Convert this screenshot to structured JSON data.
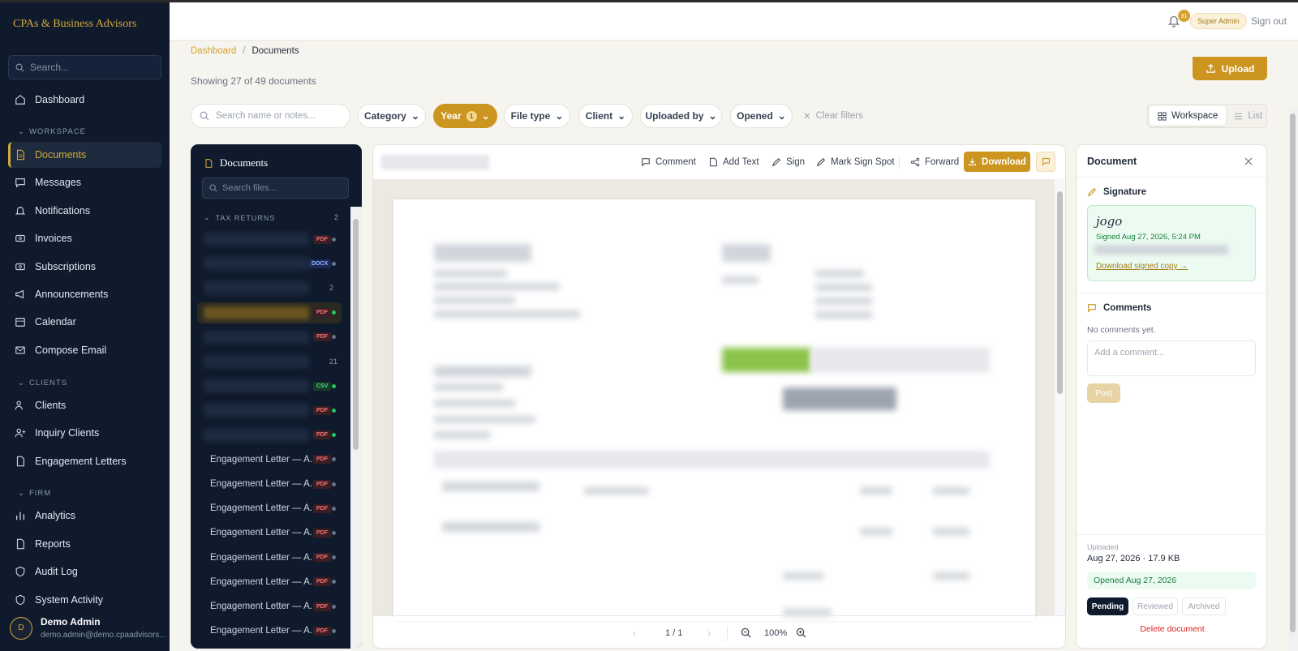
{
  "app": {
    "logo": "CPAs & Business Advisors"
  },
  "sidebar": {
    "search_placeholder": "Search...",
    "items": [
      {
        "label": "Dashboard"
      },
      {
        "label": "Documents"
      },
      {
        "label": "Messages"
      },
      {
        "label": "Notifications"
      },
      {
        "label": "Invoices"
      },
      {
        "label": "Subscriptions"
      },
      {
        "label": "Announcements"
      },
      {
        "label": "Calendar"
      },
      {
        "label": "Compose Email"
      },
      {
        "label": "Clients"
      },
      {
        "label": "Inquiry Clients"
      },
      {
        "label": "Engagement Letters"
      },
      {
        "label": "Analytics"
      },
      {
        "label": "Reports"
      },
      {
        "label": "Audit Log"
      },
      {
        "label": "System Activity"
      }
    ],
    "sections": {
      "workspace": "WORKSPACE",
      "clients": "CLIENTS",
      "firm": "FIRM"
    },
    "user": {
      "initial": "D",
      "name": "Demo Admin",
      "email": "demo.admin@demo.cpaadvisors..."
    }
  },
  "topbar": {
    "notif_count": "31",
    "role": "Super Admin",
    "signout": "Sign out"
  },
  "breadcrumb": {
    "root": "Dashboard",
    "sep": "/",
    "current": "Documents"
  },
  "summary": "Showing 27 of 49 documents",
  "upload_label": "Upload",
  "filters": {
    "search_placeholder": "Search name or notes...",
    "category": "Category",
    "year": "Year",
    "year_count": "1",
    "file_type": "File type",
    "client": "Client",
    "uploaded_by": "Uploaded by",
    "opened": "Opened",
    "clear": "Clear filters"
  },
  "view": {
    "workspace": "Workspace",
    "list": "List"
  },
  "file_panel": {
    "title": "Documents",
    "search_placeholder": "Search files...",
    "group": "TAX RETURNS",
    "group_count": "2",
    "rows": [
      {
        "name": "",
        "badge": "PDF",
        "count": "",
        "opened": false
      },
      {
        "name": "",
        "badge": "DOCX",
        "count": "",
        "opened": false
      },
      {
        "name": "",
        "badge": "",
        "count": "2",
        "opened": false
      },
      {
        "name": "",
        "badge": "PDF",
        "count": "",
        "opened": true
      },
      {
        "name": "",
        "badge": "PDF",
        "count": "",
        "opened": false
      },
      {
        "name": "",
        "badge": "",
        "count": "21",
        "opened": false
      },
      {
        "name": "",
        "badge": "CSV",
        "count": "",
        "opened": true
      },
      {
        "name": "",
        "badge": "PDF",
        "count": "",
        "opened": true
      },
      {
        "name": "",
        "badge": "PDF",
        "count": "",
        "opened": true
      },
      {
        "name": "Engagement Letter — A...",
        "badge": "PDF",
        "count": "",
        "opened": false
      },
      {
        "name": "Engagement Letter — A...",
        "badge": "PDF",
        "count": "",
        "opened": false
      },
      {
        "name": "Engagement Letter — A...",
        "badge": "PDF",
        "count": "",
        "opened": false
      },
      {
        "name": "Engagement Letter — A...",
        "badge": "PDF",
        "count": "",
        "opened": false
      },
      {
        "name": "Engagement Letter — A...",
        "badge": "PDF",
        "count": "",
        "opened": false
      },
      {
        "name": "Engagement Letter — A...",
        "badge": "PDF",
        "count": "",
        "opened": false
      },
      {
        "name": "Engagement Letter — A...",
        "badge": "PDF",
        "count": "",
        "opened": false
      },
      {
        "name": "Engagement Letter — A...",
        "badge": "PDF",
        "count": "",
        "opened": false
      }
    ]
  },
  "viewer": {
    "tools": {
      "comment": "Comment",
      "add_text": "Add Text",
      "sign": "Sign",
      "mark_sign_spot": "Mark Sign Spot",
      "forward": "Forward",
      "download": "Download"
    },
    "page_indicator": "1 / 1",
    "zoom": "100%"
  },
  "detail": {
    "title": "Document",
    "signature_heading": "Signature",
    "signature_script": "jogo",
    "signed_text": "Signed Aug 27, 2026, 5:24 PM",
    "download_signed": "Download signed copy →",
    "comments_heading": "Comments",
    "no_comments": "No comments yet.",
    "comment_placeholder": "Add a comment...",
    "post": "Post",
    "uploaded_label": "Uploaded",
    "uploaded_value": "Aug 27, 2026 · 17.9 KB",
    "opened": "Opened Aug 27, 2026",
    "statuses": [
      "Pending",
      "Reviewed",
      "Archived"
    ],
    "delete": "Delete document"
  },
  "colors": {
    "accent": "#cc9520",
    "sidebar_bg": "#0f1b2d",
    "success": "#15803d",
    "danger": "#dc2626"
  }
}
